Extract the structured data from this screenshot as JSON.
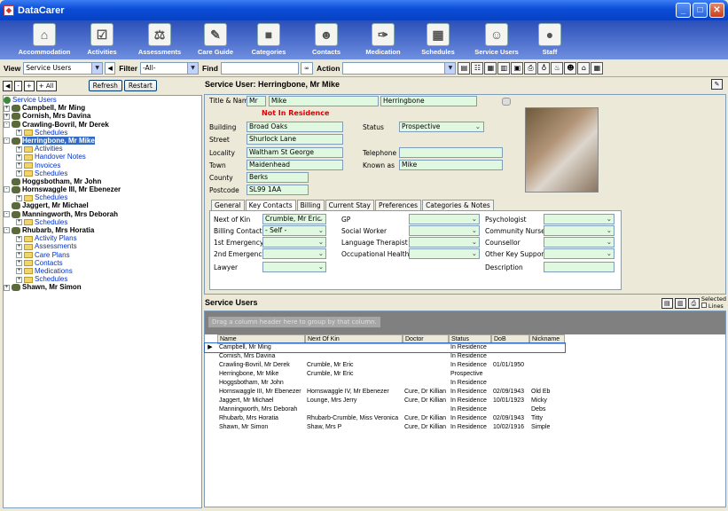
{
  "window": {
    "title": "DataCarer"
  },
  "toolbar": [
    {
      "label": "Accommodation",
      "icon": "house-icon"
    },
    {
      "label": "Activities",
      "icon": "checklist-icon"
    },
    {
      "label": "Assessments",
      "icon": "scales-icon"
    },
    {
      "label": "Care Guide",
      "icon": "pencil-icon"
    },
    {
      "label": "Categories",
      "icon": "cube-icon"
    },
    {
      "label": "Contacts",
      "icon": "people-icon"
    },
    {
      "label": "Medication",
      "icon": "syringe-icon"
    },
    {
      "label": "Schedules",
      "icon": "calendar-icon"
    },
    {
      "label": "Service Users",
      "icon": "user-icon"
    },
    {
      "label": "Staff",
      "icon": "staff-icon"
    }
  ],
  "filterbar": {
    "view_label": "View",
    "view_value": "Service Users",
    "filter_label": "Filter",
    "filter_value": "-All-",
    "find_label": "Find",
    "action_label": "Action"
  },
  "nav": {
    "refresh": "Refresh",
    "restart": "Restart",
    "plus": "+",
    "minus": "-",
    "plusall": "+ All"
  },
  "tree": [
    {
      "label": "Service Users",
      "type": "root"
    },
    {
      "label": "Campbell, Mr Ming",
      "type": "person",
      "exp": "+"
    },
    {
      "label": "Cornish, Mrs Davina",
      "type": "person",
      "exp": "+"
    },
    {
      "label": "Crawling-Bovril, Mr Derek",
      "type": "person",
      "exp": "-"
    },
    {
      "label": "Schedules",
      "type": "folder",
      "indent": 1
    },
    {
      "label": "Herringbone, Mr Mike",
      "type": "person",
      "exp": "-",
      "selected": true
    },
    {
      "label": "Activities",
      "type": "folder",
      "indent": 1
    },
    {
      "label": "Handover Notes",
      "type": "folder",
      "indent": 1
    },
    {
      "label": "Invoices",
      "type": "folder",
      "indent": 1
    },
    {
      "label": "Schedules",
      "type": "folder",
      "indent": 1
    },
    {
      "label": "Hoggsbotham, Mr John",
      "type": "person",
      "exp": ""
    },
    {
      "label": "Hornswaggle III, Mr Ebenezer",
      "type": "person",
      "exp": "-"
    },
    {
      "label": "Schedules",
      "type": "folder",
      "indent": 1
    },
    {
      "label": "Jaggert, Mr Michael",
      "type": "person",
      "exp": ""
    },
    {
      "label": "Manningworth, Mrs Deborah",
      "type": "person",
      "exp": "-"
    },
    {
      "label": "Schedules",
      "type": "folder",
      "indent": 1
    },
    {
      "label": "Rhubarb, Mrs Horatia",
      "type": "person",
      "exp": "-"
    },
    {
      "label": "Activity Plans",
      "type": "folder",
      "indent": 1
    },
    {
      "label": "Assessments",
      "type": "folder",
      "indent": 1
    },
    {
      "label": "Care Plans",
      "type": "folder",
      "indent": 1
    },
    {
      "label": "Contacts",
      "type": "folder",
      "indent": 1
    },
    {
      "label": "Medications",
      "type": "folder",
      "indent": 1
    },
    {
      "label": "Schedules",
      "type": "folder",
      "indent": 1
    },
    {
      "label": "Shawn, Mr Simon",
      "type": "person",
      "exp": "+"
    }
  ],
  "detail": {
    "header": "Service User: Herringbone, Mr Mike",
    "title_names_label": "Title & Names",
    "title": "Mr",
    "first": "Mike",
    "surname": "Herringbone",
    "not_in_residence": "Not In Residence",
    "building_label": "Building",
    "building": "Broad Oaks",
    "street_label": "Street",
    "street": "Shurlock Lane",
    "locality_label": "Locality",
    "locality": "Waltham St George",
    "town_label": "Town",
    "town": "Maidenhead",
    "county_label": "County",
    "county": "Berks",
    "postcode_label": "Postcode",
    "postcode": "SL99 1AA",
    "status_label": "Status",
    "status": "Prospective",
    "telephone_label": "Telephone",
    "telephone": "",
    "known_as_label": "Known as",
    "known_as": "Mike"
  },
  "tabs": [
    "General",
    "Key Contacts",
    "Billing",
    "Current Stay",
    "Preferences",
    "Categories & Notes"
  ],
  "keycontacts": {
    "next_of_kin_label": "Next of Kin",
    "next_of_kin": "Crumble, Mr Eric",
    "billing_contact_label": "Billing Contact",
    "billing_contact": "- Self -",
    "first_emergency_label": "1st Emergency",
    "second_emergency_label": "2nd Emergency",
    "lawyer_label": "Lawyer",
    "gp_label": "GP",
    "social_worker_label": "Social Worker",
    "language_therapist_label": "Language Therapist",
    "occupational_health_label": "Occupational Health",
    "psychologist_label": "Psychologist",
    "community_nurse_label": "Community Nurse",
    "counsellor_label": "Counsellor",
    "other_key_support_label": "Other Key Support",
    "description_label": "Description"
  },
  "users_grid": {
    "title": "Service Users",
    "group_hint": "Drag a column header here to group by that column.",
    "selected_label": "Selected",
    "lines_label": "Lines",
    "columns": [
      "Name",
      "Next Of Kin",
      "Doctor",
      "Status",
      "DoB",
      "Nickname"
    ],
    "rows": [
      [
        "Campbell, Mr Ming",
        "",
        "",
        "In Residence",
        "",
        ""
      ],
      [
        "Cornish, Mrs Davina",
        "",
        "",
        "In Residence",
        "",
        ""
      ],
      [
        "Crawling-Bovril, Mr Derek",
        "Crumble, Mr Eric",
        "",
        "In Residence",
        "01/01/1950",
        ""
      ],
      [
        "Herringbone, Mr Mike",
        "Crumble, Mr Eric",
        "",
        "Prospective",
        "",
        ""
      ],
      [
        "Hoggsbotham, Mr John",
        "",
        "",
        "In Residence",
        "",
        ""
      ],
      [
        "Hornswaggle III, Mr Ebenezer",
        "Hornswaggle IV, Mr Ebenezer",
        "Cure, Dr Killian",
        "In Residence",
        "02/09/1943",
        "Old Eb"
      ],
      [
        "Jaggert, Mr Michael",
        "Lounge, Mrs Jerry",
        "Cure, Dr Killian",
        "In Residence",
        "10/01/1923",
        "Micky"
      ],
      [
        "Manningworth, Mrs Deborah",
        "",
        "",
        "In Residence",
        "",
        "Debs"
      ],
      [
        "Rhubarb, Mrs Horatia",
        "Rhubarb-Crumble, Miss Veronica",
        "Cure, Dr Killian",
        "In Residence",
        "02/09/1943",
        "Titty"
      ],
      [
        "Shawn, Mr Simon",
        "Shaw, Mrs P",
        "Cure, Dr Killian",
        "In Residence",
        "10/02/1916",
        "Simple"
      ]
    ]
  }
}
